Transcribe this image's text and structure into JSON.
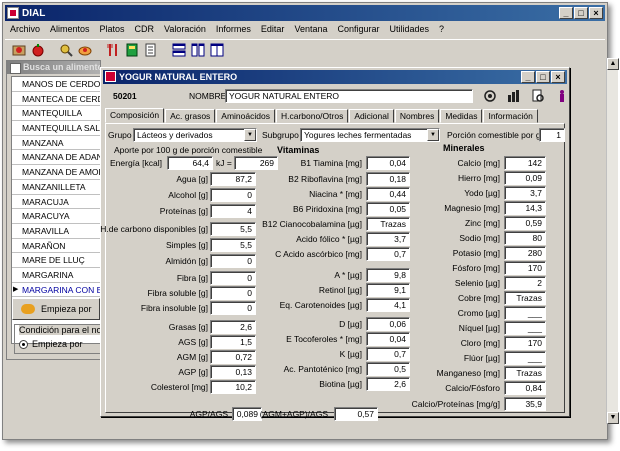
{
  "app": {
    "title": "DIAL",
    "menu": [
      "Archivo",
      "Alimentos",
      "Platos",
      "CDR",
      "Valoración",
      "Informes",
      "Editar",
      "Ventana",
      "Configurar",
      "Utilidades",
      "?"
    ],
    "window_buttons": [
      "_",
      "□",
      "×"
    ]
  },
  "toolbar": {
    "icons": [
      "new-food-icon",
      "apple-icon",
      "search-food-icon",
      "dish-icon",
      "utensils-icon",
      "book-icon",
      "document-icon",
      "tile-horizontal-icon",
      "tile-vertical-icon",
      "window-icon"
    ]
  },
  "background_window": {
    "title": "Busca un alimento",
    "items": [
      "MANOS DE CERDO",
      "MANTECA DE CERDO",
      "MANTEQUILLA",
      "MANTEQUILLA SALA",
      "MANZANA",
      "MANZANA DE ADAN",
      "MANZANA DE AMOF",
      "MANZANILLETA",
      "MARACUJA",
      "MARACUYA",
      "MARAVILLA",
      "MARAÑON",
      "MARE DE LLUÇ",
      "MARGARINA",
      "MARGARINA CON ES"
    ],
    "selected_index": 14,
    "start_button": "Empieza por",
    "condition_label": "Condición para el nom",
    "radio_label": "Empieza por"
  },
  "dialog": {
    "title": "YOGUR NATURAL ENTERO",
    "code": "50201",
    "name_label": "NOMBRE",
    "name_value": "YOGUR NATURAL ENTERO",
    "tabs": [
      "Composición",
      "Ac. grasos",
      "Aminoácidos",
      "H.carbono/Otros",
      "Adicional",
      "Nombres",
      "Medidas",
      "Información"
    ],
    "active_tab": 0,
    "grupo_label": "Grupo",
    "grupo_value": "Lácteos y derivados",
    "subgrupo_label": "Subgrupo",
    "subgrupo_value": "Yogures leches fermentadas",
    "porcion_label": "Porción comestible por g.",
    "porcion_value": "1",
    "aporte_label": "Aporte por 100 g de porción comestible",
    "energia_label": "Energía [kcal]",
    "energia_value": "64,4",
    "kj_label": "kJ =",
    "kj_value": "269"
  },
  "composition": [
    {
      "label": "Agua [g]",
      "value": "87,2"
    },
    {
      "label": "Alcohol [g]",
      "value": "0"
    },
    {
      "label": "Proteínas [g]",
      "value": "4"
    },
    {
      "label": "H.de carbono disponibles [g]",
      "value": "5,5"
    },
    {
      "label": "Simples [g]",
      "value": "5,5"
    },
    {
      "label": "Almidón [g]",
      "value": "0"
    },
    {
      "label": "Fibra [g]",
      "value": "0"
    },
    {
      "label": "Fibra soluble [g]",
      "value": "0"
    },
    {
      "label": "Fibra insoluble [g]",
      "value": "0"
    },
    {
      "label": "Grasas [g]",
      "value": "2,6"
    },
    {
      "label": "AGS [g]",
      "value": "1,5"
    },
    {
      "label": "AGM [g]",
      "value": "0,72"
    },
    {
      "label": "AGP [g]",
      "value": "0,13"
    },
    {
      "label": "Colesterol [mg]",
      "value": "10,2"
    },
    {
      "label": "AGP/AGS",
      "value": "0,089"
    }
  ],
  "vitamins": {
    "header": "Vitaminas",
    "items": [
      {
        "label": "B1 Tiamina [mg]",
        "value": "0,04"
      },
      {
        "label": "B2 Riboflavina [mg]",
        "value": "0,18"
      },
      {
        "label": "Niacina * [mg]",
        "value": "0,44"
      },
      {
        "label": "B6 Piridoxina [mg]",
        "value": "0,05"
      },
      {
        "label": "B12 Cianocobalamina [µg]",
        "value": "Trazas"
      },
      {
        "label": "Acido fólico * [µg]",
        "value": "3,7"
      },
      {
        "label": "C Acido ascórbico [mg]",
        "value": "0,7"
      },
      {
        "label": "A * [µg]",
        "value": "9,8"
      },
      {
        "label": "Retinol [µg]",
        "value": "9,1"
      },
      {
        "label": "Eq. Carotenoides [µg]",
        "value": "4,1"
      },
      {
        "label": "D [µg]",
        "value": "0,06"
      },
      {
        "label": "E Tocoferoles * [mg]",
        "value": "0,04"
      },
      {
        "label": "K [µg]",
        "value": "0,7"
      },
      {
        "label": "Ac. Pantoténico [mg]",
        "value": "0,5"
      },
      {
        "label": "Biotina [µg]",
        "value": "2,6"
      },
      {
        "label": "(AGM+AGP)/AGS",
        "value": "0,57"
      }
    ]
  },
  "minerals": {
    "header": "Minerales",
    "items": [
      {
        "label": "Calcio [mg]",
        "value": "142"
      },
      {
        "label": "Hierro [mg]",
        "value": "0,09"
      },
      {
        "label": "Yodo [µg]",
        "value": "3,7"
      },
      {
        "label": "Magnesio [mg]",
        "value": "14,3"
      },
      {
        "label": "Zinc [mg]",
        "value": "0,59"
      },
      {
        "label": "Sodio [mg]",
        "value": "80"
      },
      {
        "label": "Potasio [mg]",
        "value": "280"
      },
      {
        "label": "Fósforo [mg]",
        "value": "170"
      },
      {
        "label": "Selenio [µg]",
        "value": "2"
      },
      {
        "label": "Cobre [mg]",
        "value": "Trazas"
      },
      {
        "label": "Cromo [µg]",
        "value": "___"
      },
      {
        "label": "Níquel [µg]",
        "value": "___"
      },
      {
        "label": "Cloro [mg]",
        "value": "170"
      },
      {
        "label": "Flúor [µg]",
        "value": "___"
      },
      {
        "label": "Manganeso [mg]",
        "value": "Trazas"
      },
      {
        "label": "Calcio/Fósforo",
        "value": "0,84"
      },
      {
        "label": "Calcio/Proteínas [mg/g]",
        "value": "35,9"
      }
    ]
  }
}
